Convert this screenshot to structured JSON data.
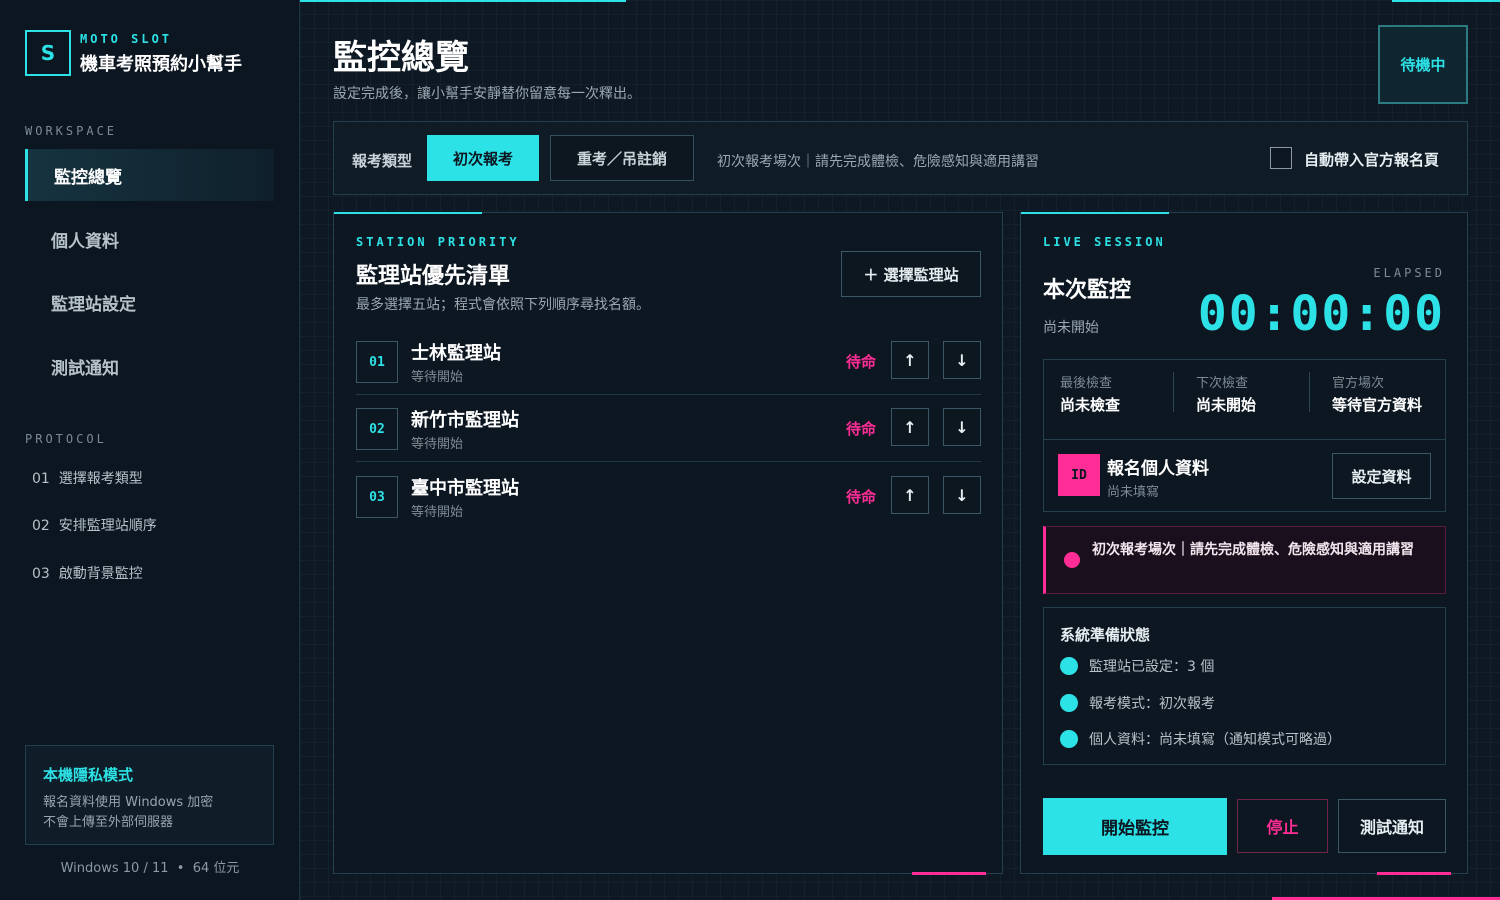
{
  "brand": {
    "logo_letter": "S",
    "subtitle": "MOTO SLOT",
    "title": "機車考照預約小幫手"
  },
  "sidebar": {
    "workspace_label": "WORKSPACE",
    "items": [
      {
        "label": "監控總覽",
        "active": true
      },
      {
        "label": "個人資料",
        "active": false
      },
      {
        "label": "監理站設定",
        "active": false
      },
      {
        "label": "測試通知",
        "active": false
      }
    ],
    "protocol_label": "PROTOCOL",
    "protocol_steps": [
      "01  選擇報考類型",
      "02  安排監理站順序",
      "03  啟動背景監控"
    ],
    "privacy": {
      "title": "本機隱私模式",
      "line1": "報名資料使用 Windows 加密",
      "line2": "不會上傳至外部伺服器"
    },
    "os_info": "Windows 10 / 11  •  64 位元"
  },
  "header": {
    "title": "監控總覽",
    "subtitle": "設定完成後，讓小幫手安靜替你留意每一次釋出。",
    "status": "待機中"
  },
  "exam_type": {
    "label": "報考類型",
    "options": [
      "初次報考",
      "重考／吊註銷"
    ],
    "selected": "初次報考",
    "note": "初次報考場次｜請先完成體檢、危險感知與適用講習",
    "auto_open_label": "自動帶入官方報名頁",
    "auto_open_checked": false
  },
  "stations": {
    "eyebrow": "STATION PRIORITY",
    "title": "監理站優先清單",
    "description": "最多選擇五站；程式會依照下列順序尋找名額。",
    "select_button": "＋ 選擇監理站",
    "rows": [
      {
        "num": "01",
        "name": "士林監理站",
        "status": "等待開始",
        "state": "待命"
      },
      {
        "num": "02",
        "name": "新竹市監理站",
        "status": "等待開始",
        "state": "待命"
      },
      {
        "num": "03",
        "name": "臺中市監理站",
        "status": "等待開始",
        "state": "待命"
      }
    ],
    "up_icon": "↑",
    "down_icon": "↓"
  },
  "session": {
    "eyebrow": "LIVE SESSION",
    "title": "本次監控",
    "state": "尚未開始",
    "elapsed_label": "ELAPSED",
    "elapsed": "00:00:00",
    "stats": [
      {
        "label": "最後檢查",
        "value": "尚未檢查"
      },
      {
        "label": "下次檢查",
        "value": "尚未開始"
      },
      {
        "label": "官方場次",
        "value": "等待官方資料"
      }
    ],
    "profile": {
      "badge": "ID",
      "title": "報名個人資料",
      "state": "尚未填寫",
      "button": "設定資料"
    },
    "alert": "初次報考場次｜請先完成體檢、危險感知與適用講習",
    "readiness": {
      "title": "系統準備狀態",
      "items": [
        "監理站已設定：3 個",
        "報考模式：初次報考",
        "個人資料：尚未填寫（通知模式可略過）"
      ]
    },
    "actions": {
      "start": "開始監控",
      "stop": "停止",
      "test": "測試通知"
    }
  },
  "colors": {
    "accent": "#2de2e6",
    "alert": "#ff2d95",
    "background": "#0c1620"
  }
}
